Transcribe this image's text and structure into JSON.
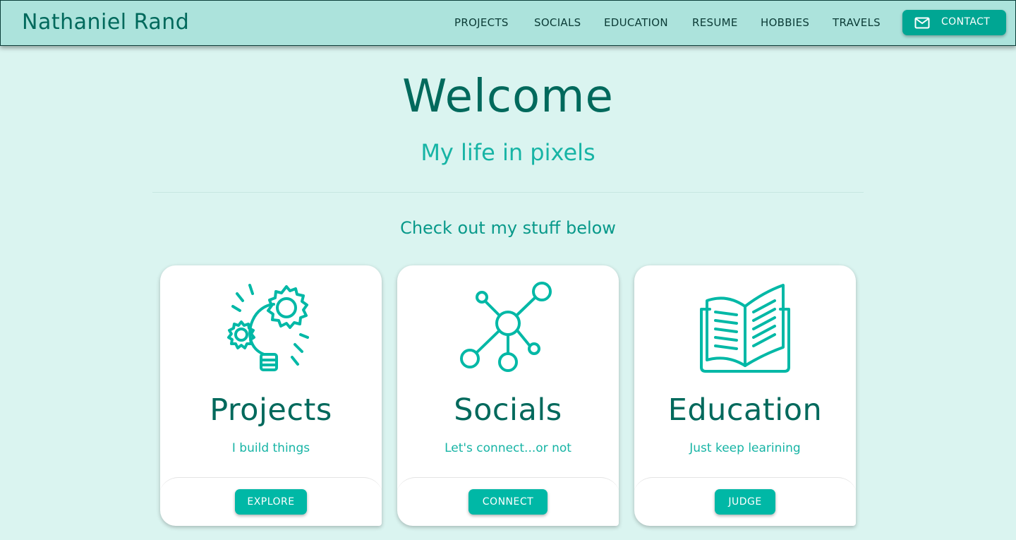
{
  "header": {
    "brand": "Nathaniel Rand",
    "nav": [
      "PROJECTS",
      "SOCIALS",
      "EDUCATION",
      "RESUME",
      "HOBBIES",
      "TRAVELS"
    ],
    "contact_label": "CONTACT",
    "contact_icon": "mail-icon"
  },
  "hero": {
    "title": "Welcome",
    "subtitle": "My life in pixels",
    "section_title": "Check out my stuff below"
  },
  "cards": [
    {
      "icon": "lightbulb-gears-icon",
      "title": "Projects",
      "text": "I build things",
      "button": "EXPLORE"
    },
    {
      "icon": "network-nodes-icon",
      "title": "Socials",
      "text": "Let's connect...or not",
      "button": "CONNECT"
    },
    {
      "icon": "open-book-icon",
      "title": "Education",
      "text": "Just keep learining",
      "button": "JUDGE"
    }
  ],
  "colors": {
    "header_bg": "#ace3dc",
    "page_bg": "#daf4f0",
    "primary_dark": "#00695c",
    "accent": "#00b8a6",
    "accent_dark": "#00a693"
  }
}
